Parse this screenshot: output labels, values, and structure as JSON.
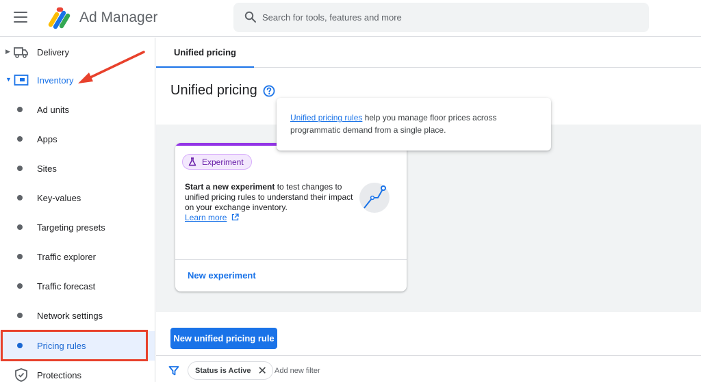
{
  "header": {
    "app_title": "Ad Manager",
    "search_placeholder": "Search for tools, features and more"
  },
  "sidebar": {
    "items": [
      {
        "label": "Delivery",
        "icon": "truck-icon",
        "kind": "section"
      },
      {
        "label": "Inventory",
        "icon": "inventory-icon",
        "kind": "section-expanded"
      },
      {
        "label": "Ad units",
        "kind": "child"
      },
      {
        "label": "Apps",
        "kind": "child"
      },
      {
        "label": "Sites",
        "kind": "child"
      },
      {
        "label": "Key-values",
        "kind": "child"
      },
      {
        "label": "Targeting presets",
        "kind": "child"
      },
      {
        "label": "Traffic explorer",
        "kind": "child"
      },
      {
        "label": "Traffic forecast",
        "kind": "child"
      },
      {
        "label": "Network settings",
        "kind": "child"
      },
      {
        "label": "Pricing rules",
        "kind": "child-selected"
      },
      {
        "label": "Protections",
        "icon": "shield-icon",
        "kind": "section"
      }
    ]
  },
  "tabs": [
    {
      "label": "Unified pricing"
    }
  ],
  "main": {
    "title": "Unified pricing",
    "tooltip": {
      "link": "Unified pricing rules",
      "text": " help you manage floor prices across programmatic demand from a single place."
    },
    "card": {
      "chip": "Experiment",
      "bold": "Start a new experiment",
      "text": " to test changes to unified pricing rules to understand their impact on your exchange inventory.",
      "learn_more": "Learn more",
      "action": "New experiment"
    },
    "primary_button": "New unified pricing rule"
  },
  "filters": {
    "chip": "Status is Active",
    "add": "Add new filter"
  },
  "colors": {
    "accent": "#1a73e8",
    "annotation_red": "#e8412c",
    "experiment_purple": "#9334e6"
  }
}
